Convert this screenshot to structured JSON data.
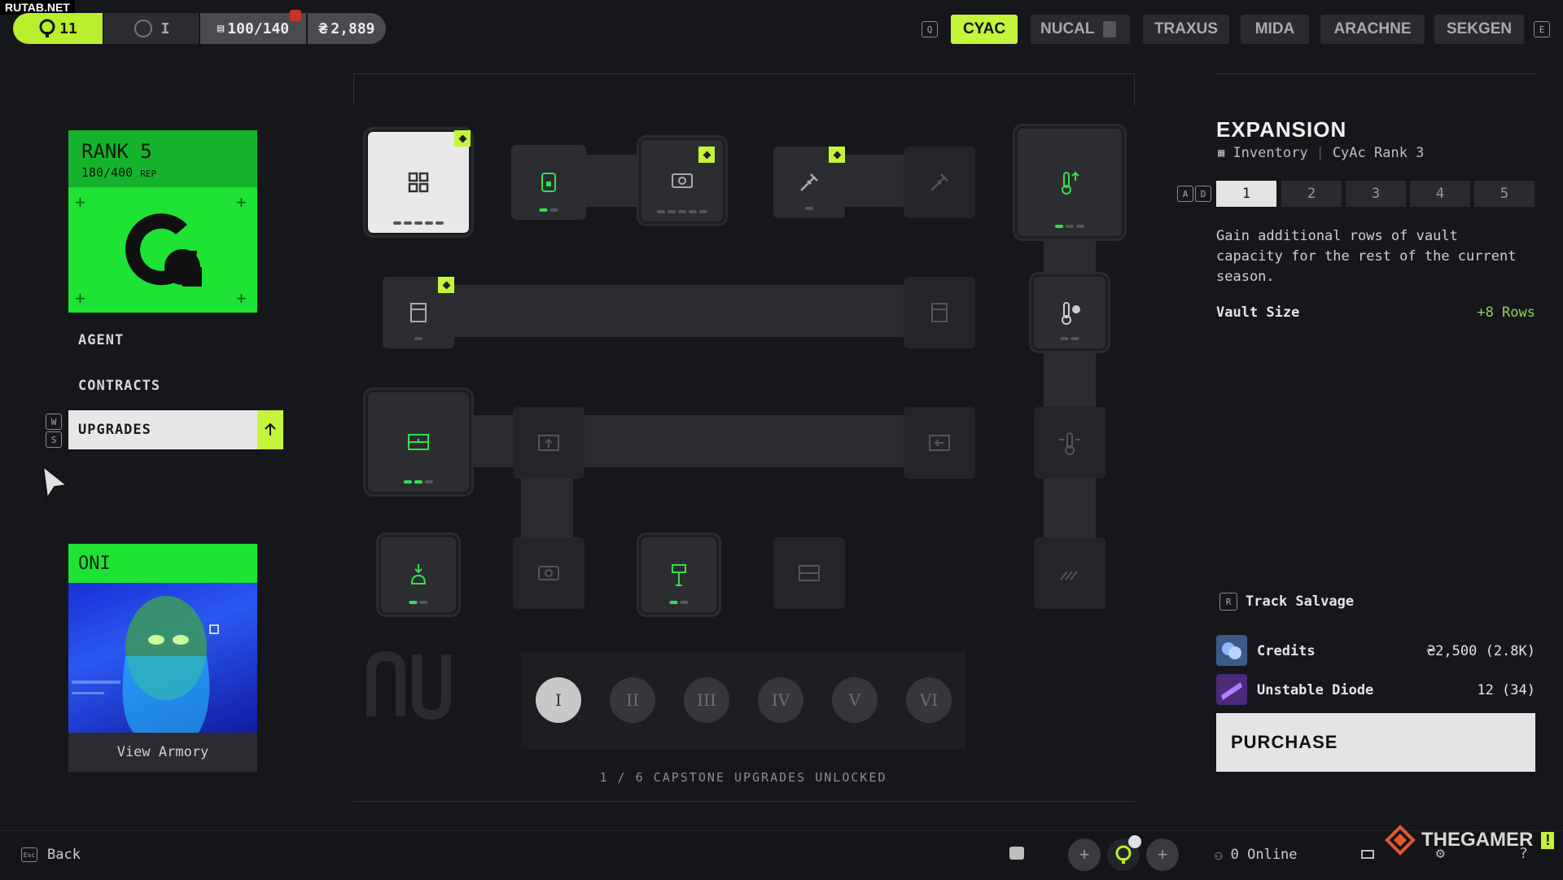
{
  "watermark": "RUTAB.NET",
  "topbar": {
    "level": "11",
    "rank_numeral": "I",
    "capacity": "100/140",
    "credits": "2,889",
    "key_left": "Q",
    "key_right": "E",
    "tabs": [
      "CYAC",
      "NUCAL",
      "TRAXUS",
      "MIDA",
      "ARACHNE",
      "SEKGEN"
    ],
    "active_tab": "CYAC"
  },
  "rank_card": {
    "title": "RANK 5",
    "progress": "180/400",
    "progress_suffix": "REP"
  },
  "nav": {
    "items": [
      "AGENT",
      "CONTRACTS",
      "UPGRADES"
    ],
    "active": "UPGRADES",
    "key_up": "W",
    "key_down": "S"
  },
  "agent_card": {
    "name": "ONI",
    "button": "View Armory"
  },
  "tree": {
    "capstones": [
      "I",
      "II",
      "III",
      "IV",
      "V",
      "VI"
    ],
    "active_capstone": "I",
    "capstone_status": "1 / 6 CAPSTONE UPGRADES UNLOCKED"
  },
  "detail": {
    "title": "EXPANSION",
    "category": "Inventory",
    "requirement": "CyAc Rank 3",
    "level_keys": "A D",
    "levels": [
      "1",
      "2",
      "3",
      "4",
      "5"
    ],
    "active_level": "1",
    "description": "Gain additional rows of vault capacity for the rest of the current season.",
    "stat_label": "Vault Size",
    "stat_value": "+8 Rows",
    "track_key": "R",
    "track_label": "Track Salvage",
    "costs": [
      {
        "name": "Credits",
        "amount": "2,500 (2.8K)"
      },
      {
        "name": "Unstable Diode",
        "amount": "12 (34)"
      }
    ],
    "purchase_label": "PURCHASE"
  },
  "bottombar": {
    "back_key": "Esc",
    "back_label": "Back",
    "online_label": "0 Online",
    "brand": "THEGAMER"
  },
  "colors": {
    "accent": "#c3f53c",
    "green": "#1ee234",
    "node": "#2c2d31",
    "background": "#16171a"
  }
}
